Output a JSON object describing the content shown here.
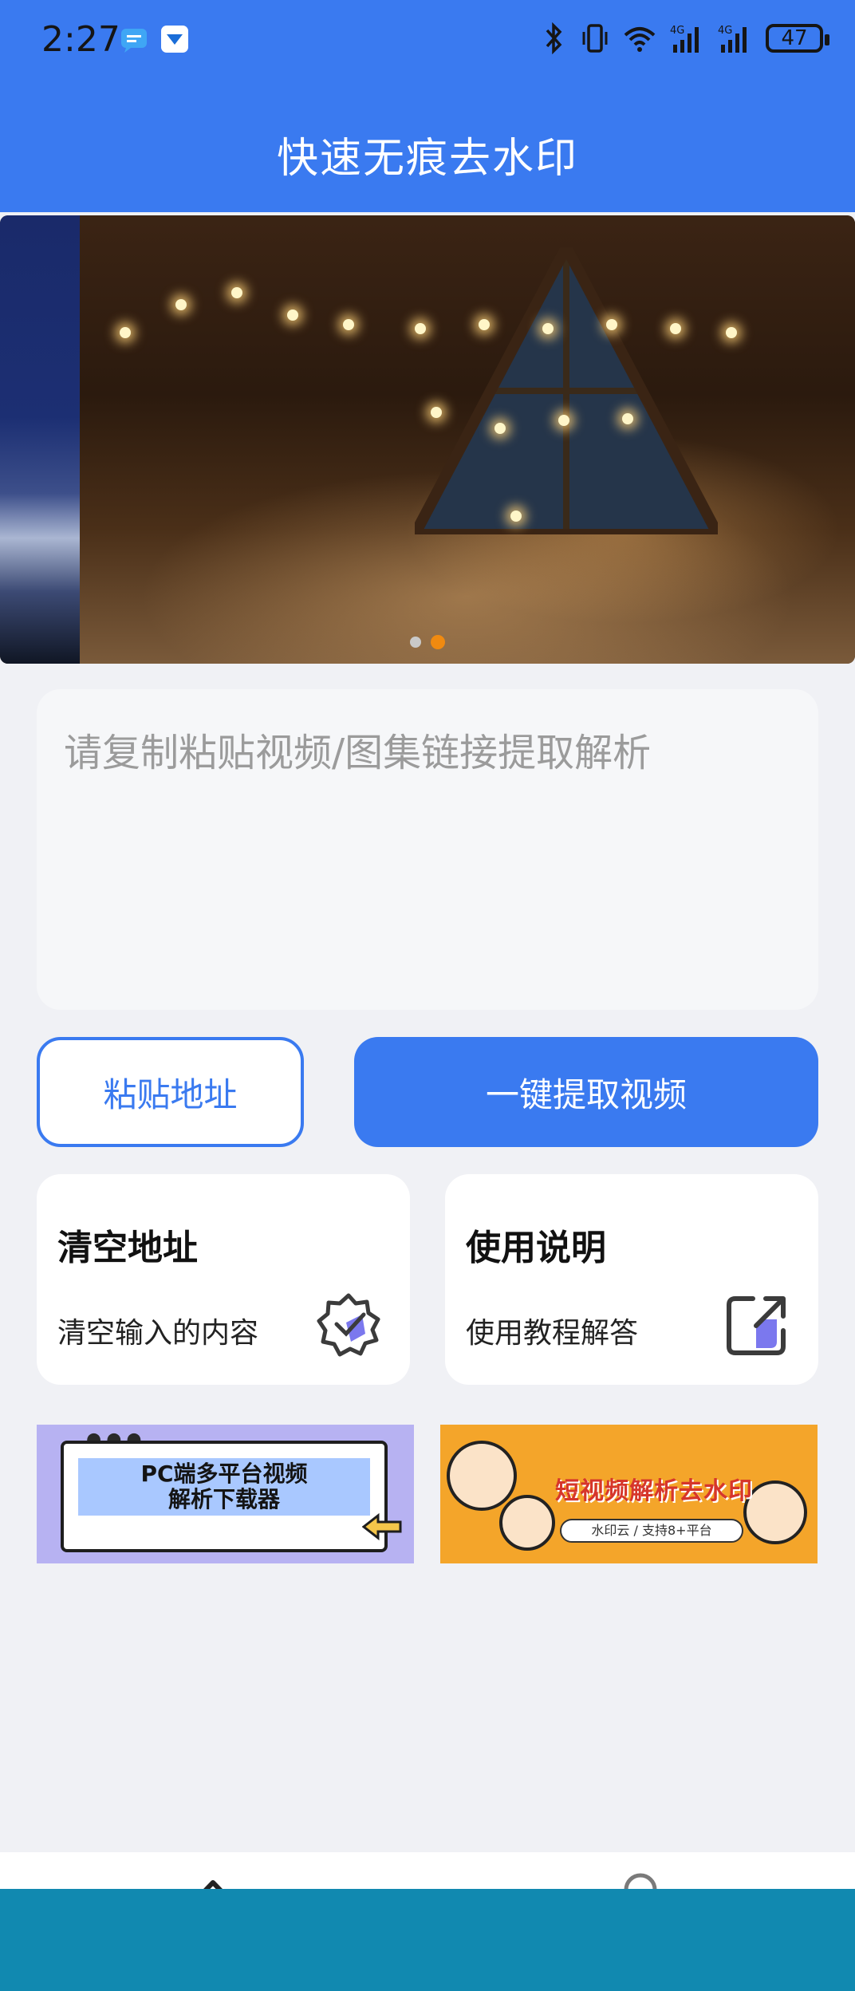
{
  "status_bar": {
    "time": "2:27",
    "battery": "47",
    "icons": [
      "message-icon",
      "app-notification-icon",
      "bluetooth-icon",
      "vibrate-icon",
      "wifi-icon",
      "signal-4g-icon",
      "signal-4g-icon"
    ]
  },
  "header": {
    "title": "快速无痕去水印"
  },
  "banner": {
    "slides": 2,
    "active_slide": 2
  },
  "input": {
    "placeholder": "请复制粘贴视频/图集链接提取解析",
    "value": ""
  },
  "actions": {
    "paste_label": "粘贴地址",
    "extract_label": "一键提取视频"
  },
  "cards": [
    {
      "title": "清空地址",
      "subtitle": "清空输入的内容",
      "icon": "verified-badge-icon"
    },
    {
      "title": "使用说明",
      "subtitle": "使用教程解答",
      "icon": "external-link-icon"
    }
  ],
  "promos": [
    {
      "line1": "PC端多平台视频",
      "line2": "解析下载器"
    },
    {
      "title": "短视频解析去水印",
      "tag": "水印云 / 支持8+平台"
    }
  ],
  "colors": {
    "primary": "#3a7af0",
    "background": "#f0f1f5",
    "accent_dot": "#f08a10"
  }
}
